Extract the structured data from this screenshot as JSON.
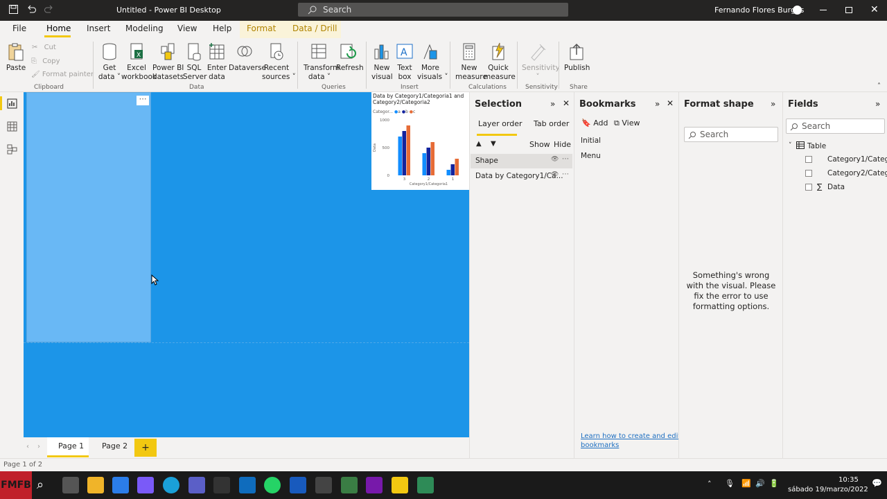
{
  "titlebar": {
    "title": "Untitled - Power BI Desktop",
    "search_placeholder": "Search",
    "user": "Fernando Flores Burgos"
  },
  "menu": [
    "File",
    "Home",
    "Insert",
    "Modeling",
    "View",
    "Help",
    "Format",
    "Data / Drill"
  ],
  "ribbon": {
    "paste": "Paste",
    "cut": "Cut",
    "copy": "Copy",
    "format_painter": "Format painter",
    "clipboard": "Clipboard",
    "get_data": [
      "Get",
      "data ˅"
    ],
    "excel": [
      "Excel",
      "workbook"
    ],
    "pbi_datasets": [
      "Power BI",
      "datasets"
    ],
    "sql": [
      "SQL",
      "Server"
    ],
    "enter_data": [
      "Enter",
      "data"
    ],
    "dataverse": "Dataverse",
    "recent": [
      "Recent",
      "sources ˅"
    ],
    "data_group": "Data",
    "transform": [
      "Transform",
      "data ˅"
    ],
    "refresh": "Refresh",
    "queries_group": "Queries",
    "new_visual": [
      "New",
      "visual"
    ],
    "text_box": [
      "Text",
      "box"
    ],
    "more_visuals": [
      "More",
      "visuals ˅"
    ],
    "insert_group": "Insert",
    "new_measure": [
      "New",
      "measure"
    ],
    "quick_measure": [
      "Quick",
      "measure"
    ],
    "calc_group": "Calculations",
    "sensitivity": "Sensitivity",
    "sens_group": "Sensitivity",
    "publish": "Publish",
    "share_group": "Share"
  },
  "chart": {
    "title": "Data by Category1/Categoria1 and Category2/Categoria2",
    "legend_title": "Categor...",
    "legend": [
      "a",
      "b",
      "c"
    ],
    "ylabel": "Data",
    "xlabel": "Category1/Categoria1"
  },
  "chart_data": {
    "type": "bar",
    "categories": [
      "3",
      "2",
      "1"
    ],
    "series": [
      {
        "name": "a",
        "values": [
          700,
          400,
          100
        ]
      },
      {
        "name": "b",
        "values": [
          800,
          500,
          200
        ]
      },
      {
        "name": "c",
        "values": [
          900,
          600,
          300
        ]
      }
    ],
    "ylim": [
      0,
      1000
    ],
    "yticks": [
      "1000",
      "500",
      "0"
    ],
    "xlabel": "Category1/Categoria1",
    "ylabel": "Data",
    "title": "Data by Category1/Categoria1 and Category2/Categoria2",
    "colors": {
      "a": "#118dff",
      "b": "#12239e",
      "c": "#e66c37"
    }
  },
  "pages": {
    "tabs": [
      "Page 1",
      "Page 2"
    ],
    "add": "+",
    "status": "Page 1 of 2"
  },
  "selection": {
    "title": "Selection",
    "tab1": "Layer order",
    "tab2": "Tab order",
    "show": "Show",
    "hide": "Hide",
    "items": [
      "Shape",
      "Data by Category1/Ca..."
    ]
  },
  "bookmarks": {
    "title": "Bookmarks",
    "add": "Add",
    "view": "View",
    "items": [
      "Initial",
      "Menu"
    ],
    "learn": [
      "Learn how to create and edit",
      "bookmarks"
    ]
  },
  "format": {
    "title": "Format shape",
    "search": "Search",
    "message": [
      "Something's wrong",
      "with the visual. Please",
      "fix the error to use",
      "formatting options."
    ]
  },
  "fields": {
    "title": "Fields",
    "search": "Search",
    "table": "Table",
    "items": [
      "Category1/Categ...",
      "Category2/Categ...",
      "Data"
    ]
  },
  "taskbar": {
    "time": "10:35",
    "date": "sábado 19/marzo/2022"
  },
  "colors": {
    "canvas": "#1c95e8",
    "selected_shape": "#69b8f5",
    "accent": "#f2c811"
  }
}
